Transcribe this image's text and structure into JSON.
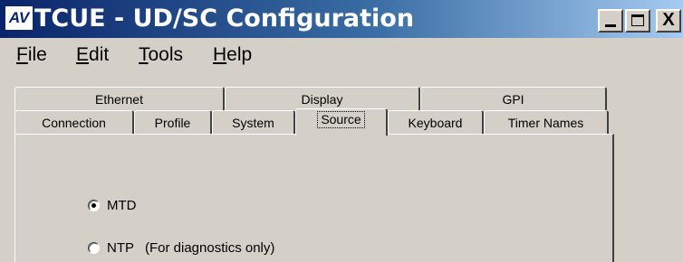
{
  "window": {
    "logo_text": "AV",
    "title": "TCUE - UD/SC Configuration",
    "minimize_label": "",
    "maximize_label": "",
    "close_label": "X"
  },
  "menu": {
    "file": {
      "mnemonic": "F",
      "rest": "ile"
    },
    "edit": {
      "mnemonic": "E",
      "rest": "dit"
    },
    "tools": {
      "mnemonic": "T",
      "rest": "ools"
    },
    "help": {
      "mnemonic": "H",
      "rest": "elp"
    }
  },
  "tabs": {
    "row1": [
      "Ethernet",
      "Display",
      "GPI"
    ],
    "row2": [
      "Connection",
      "Profile",
      "System",
      "Source",
      "Keyboard",
      "Timer Names"
    ],
    "active": "Source"
  },
  "source": {
    "options": [
      {
        "label": "MTD",
        "note": "",
        "selected": true
      },
      {
        "label": "NTP",
        "note": "(For diagnostics only)",
        "selected": false
      }
    ]
  },
  "colors": {
    "titlebar_start": "#0a246a",
    "titlebar_end": "#a6caf0",
    "face": "#d4d0c8"
  }
}
